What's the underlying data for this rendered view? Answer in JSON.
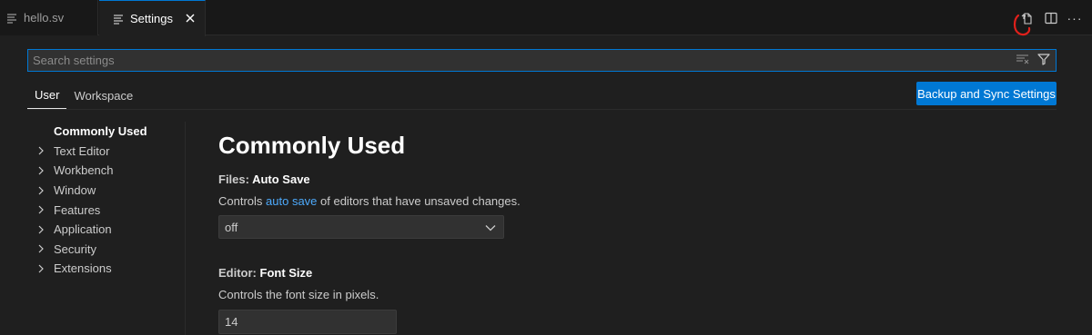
{
  "tabs": {
    "hello": {
      "label": "hello.sv",
      "icon": "lines-icon"
    },
    "settings": {
      "label": "Settings",
      "icon": "lines-icon",
      "close": "×"
    }
  },
  "actions": [
    {
      "name": "open-settings-json-icon"
    },
    {
      "name": "split-editor-icon"
    },
    {
      "name": "more-actions-icon",
      "glyph": "···"
    }
  ],
  "search": {
    "placeholder": "Search settings",
    "value": ""
  },
  "scope": {
    "user": "User",
    "workspace": "Workspace"
  },
  "sync_button": "Backup and Sync Settings",
  "toc": {
    "items": [
      {
        "label": "Commonly Used",
        "active": true
      },
      {
        "label": "Text Editor"
      },
      {
        "label": "Workbench"
      },
      {
        "label": "Window"
      },
      {
        "label": "Features"
      },
      {
        "label": "Application"
      },
      {
        "label": "Security"
      },
      {
        "label": "Extensions"
      }
    ]
  },
  "content": {
    "section_title": "Commonly Used",
    "autosave": {
      "category": "Files: ",
      "name": "Auto Save",
      "desc_before": "Controls ",
      "desc_link": "auto save",
      "desc_after": " of editors that have unsaved changes.",
      "value": "off"
    },
    "fontsize": {
      "category": "Editor: ",
      "name": "Font Size",
      "desc": "Controls the font size in pixels.",
      "value": "14"
    }
  },
  "colors": {
    "accent": "#0078d4",
    "link": "#4daafc",
    "annotation": "#e0201b"
  }
}
